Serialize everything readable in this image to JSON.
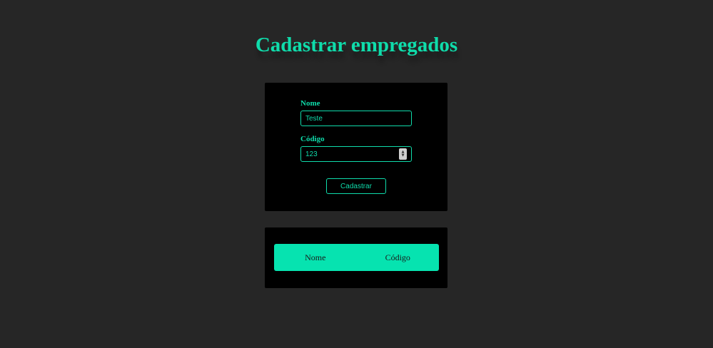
{
  "page": {
    "title": "Cadastrar empregados"
  },
  "form": {
    "name_label": "Nome",
    "name_value": "Teste",
    "code_label": "Código",
    "code_value": "123",
    "submit_label": "Cadastrar"
  },
  "table": {
    "columns": [
      "Nome",
      "Código"
    ]
  },
  "colors": {
    "background": "#262626",
    "card": "#000000",
    "accent": "#0fdcab",
    "header_fill": "#06e3b0"
  }
}
